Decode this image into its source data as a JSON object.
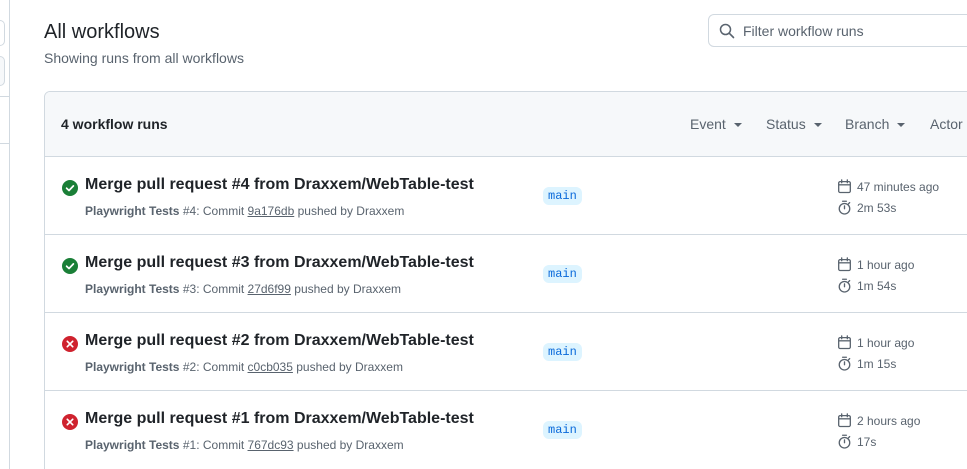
{
  "header": {
    "title": "All workflows",
    "subtitle": "Showing runs from all workflows"
  },
  "search": {
    "placeholder": "Filter workflow runs",
    "value": ""
  },
  "runs_table": {
    "count_label": "4 workflow runs",
    "filters": [
      "Event",
      "Status",
      "Branch",
      "Actor"
    ],
    "rows": [
      {
        "status": "success",
        "title": "Merge pull request #4 from Draxxem/WebTable-test",
        "workflow": "Playwright Tests",
        "run_number": "#4",
        "commit_prefix": ": Commit",
        "commit_sha": "9a176db",
        "pushed_by": "pushed by Draxxem",
        "branch": "main",
        "started": "47 minutes ago",
        "duration": "2m 53s"
      },
      {
        "status": "success",
        "title": "Merge pull request #3 from Draxxem/WebTable-test",
        "workflow": "Playwright Tests",
        "run_number": "#3",
        "commit_prefix": ": Commit",
        "commit_sha": "27d6f99",
        "pushed_by": "pushed by Draxxem",
        "branch": "main",
        "started": "1 hour ago",
        "duration": "1m 54s"
      },
      {
        "status": "failure",
        "title": "Merge pull request #2 from Draxxem/WebTable-test",
        "workflow": "Playwright Tests",
        "run_number": "#2",
        "commit_prefix": ": Commit",
        "commit_sha": "c0cb035",
        "pushed_by": "pushed by Draxxem",
        "branch": "main",
        "started": "1 hour ago",
        "duration": "1m 15s"
      },
      {
        "status": "failure",
        "title": "Merge pull request #1 from Draxxem/WebTable-test",
        "workflow": "Playwright Tests",
        "run_number": "#1",
        "commit_prefix": ": Commit",
        "commit_sha": "767dc93",
        "pushed_by": "pushed by Draxxem",
        "branch": "main",
        "started": "2 hours ago",
        "duration": "17s"
      }
    ]
  },
  "icons": {
    "success": "check-circle-fill-icon",
    "failure": "x-circle-fill-icon",
    "started": "calendar-icon",
    "duration": "stopwatch-icon",
    "search": "search-icon"
  },
  "colors": {
    "success": "#1a7f37",
    "failure": "#cf222e",
    "branch_text": "#0969da",
    "branch_bg": "#ddf4ff",
    "muted": "#59636e"
  }
}
